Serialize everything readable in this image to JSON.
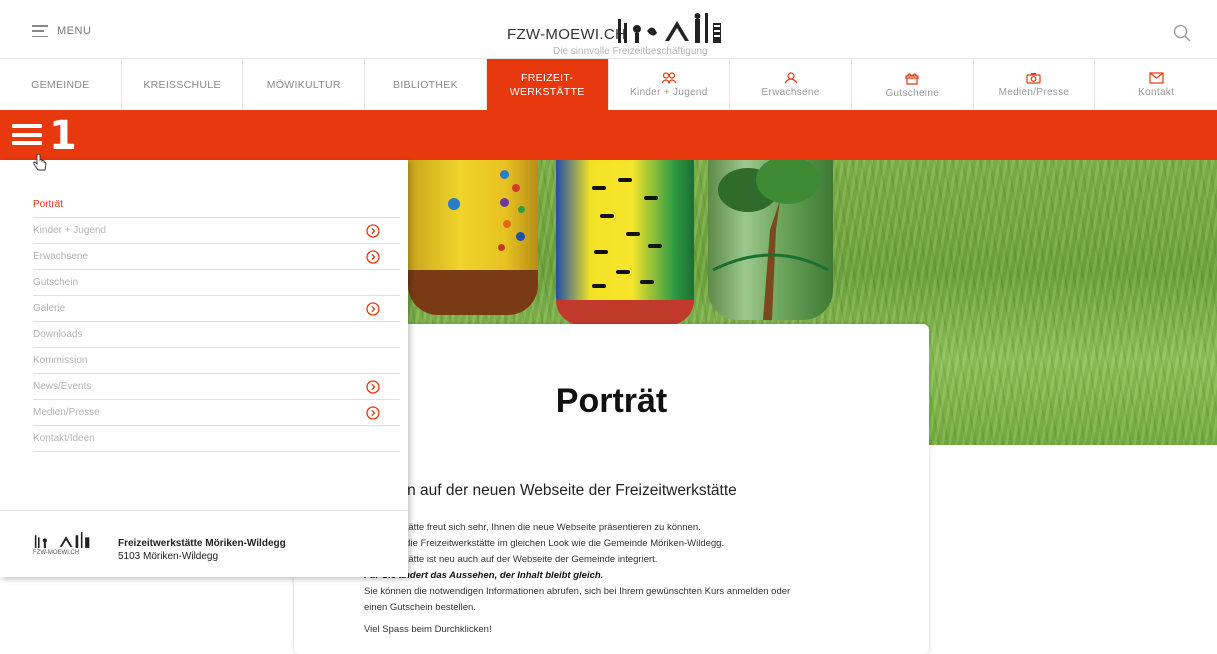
{
  "header": {
    "menu_label": "MENU",
    "brand_name": "FZW-MOEWI.CH",
    "brand_subtitle": "Die sinnvolle Freizeitbeschäftigung"
  },
  "nav": {
    "text_items": [
      "GEMEINDE",
      "KREISSCHULE",
      "MÖWIKULTUR",
      "BIBLIOTHEK"
    ],
    "active_line1": "FREIZEIT-",
    "active_line2": "WERKSTÄTTE",
    "icon_items": [
      {
        "label": "Kinder + Jugend",
        "icon": "group-icon"
      },
      {
        "label": "Erwachsene",
        "icon": "people-icon"
      },
      {
        "label": "Gutscheine",
        "icon": "gift-icon"
      },
      {
        "label": "Medien/Presse",
        "icon": "camera-icon"
      },
      {
        "label": "Kontakt",
        "icon": "mail-icon"
      }
    ]
  },
  "redbar": {
    "level": "1"
  },
  "sidemenu": {
    "items": [
      {
        "label": "Porträt"
      },
      {
        "label": "Kinder + Jugend"
      },
      {
        "label": "Erwachsene"
      },
      {
        "label": "Gutschein"
      },
      {
        "label": "Galerie"
      },
      {
        "label": "Downloads"
      },
      {
        "label": "Kommission"
      },
      {
        "label": "News/Events"
      },
      {
        "label": "Medien/Presse"
      },
      {
        "label": "Kontakt/Ideen"
      }
    ],
    "footer_logo_text": "FZW-MOEWI.CH",
    "footer_name": "Freizeitwerkstätte Möriken-Wildegg",
    "footer_address": "5103 Möriken-Wildegg"
  },
  "content": {
    "title": "Porträt",
    "heading": "ommen auf der neuen Webseite der Freizeitwerkstätte",
    "line1": "izeitwerkstätte freut sich sehr, Ihnen die neue Webseite präsentieren zu können.",
    "line2": "erscheint die Freizeitwerkstätte im gleichen Look wie die Gemeinde Möriken-Wildegg.",
    "line3": "izeitwerkstätte ist neu auch auf der Webseite der Gemeinde integriert.",
    "line4": "Für Sie ändert das Aussehen, der Inhalt bleibt gleich.",
    "line5": "Sie können die notwendigen Informationen abrufen, sich bei Ihrem gewünschten Kurs anmelden oder",
    "line6": "einen Gutschein bestellen.",
    "line7": "Viel Spass beim Durchklicken!"
  },
  "colors": {
    "accent": "#e8380d"
  }
}
